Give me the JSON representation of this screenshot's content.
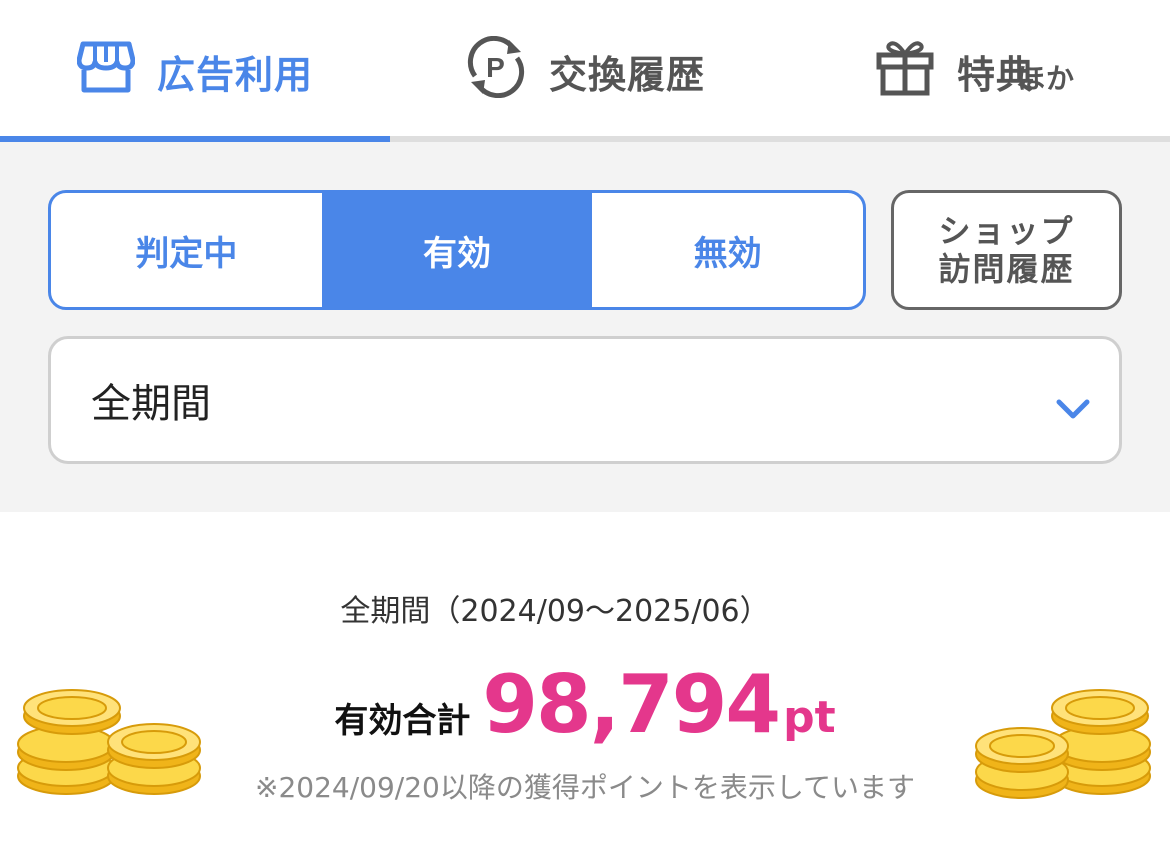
{
  "tabs": [
    {
      "label": "広告利用",
      "icon": "storefront-icon",
      "active": true
    },
    {
      "label": "交換履歴",
      "icon": "point-exchange-icon",
      "active": false
    },
    {
      "label": "特典",
      "suffix": "ほか",
      "icon": "gift-icon",
      "active": false
    }
  ],
  "status_filter": {
    "options": [
      "判定中",
      "有効",
      "無効"
    ],
    "selected": "有効"
  },
  "shop_history_button": {
    "line1": "ショップ",
    "line2": "訪問履歴"
  },
  "period_select": {
    "value": "全期間",
    "icon": "chevron-down-icon"
  },
  "summary": {
    "period_text": "全期間（2024/09〜2025/06）",
    "total_label": "有効合計",
    "total_value": "98,794",
    "unit": "pt",
    "note": "※2024/09/20以降の獲得ポイントを表示しています"
  },
  "colors": {
    "accent": "#4a86e8",
    "points": "#e4378c",
    "inactive_tab": "#555555"
  }
}
